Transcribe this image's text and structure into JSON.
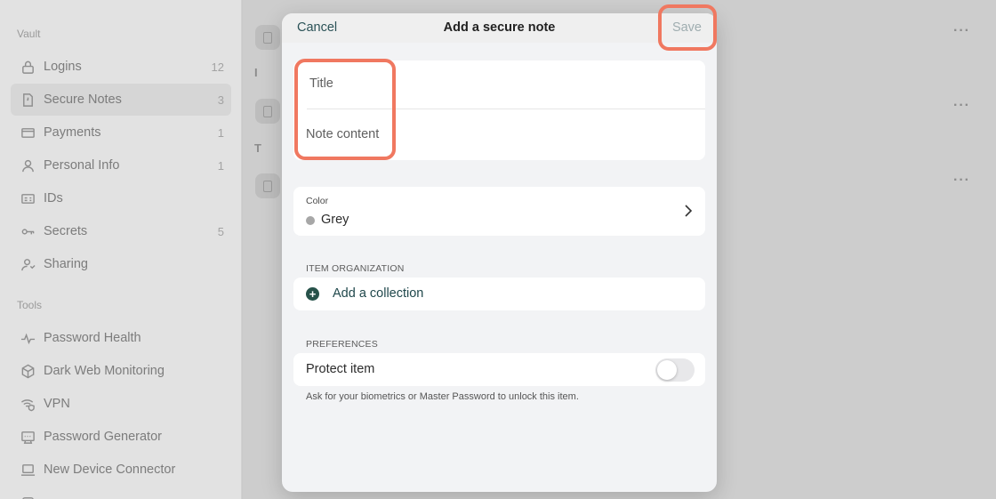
{
  "sidebar": {
    "vault_label": "Vault",
    "tools_label": "Tools",
    "vault_items": [
      {
        "label": "Logins",
        "count": "12",
        "icon": "lock-icon"
      },
      {
        "label": "Secure Notes",
        "count": "3",
        "icon": "note-icon",
        "active": true
      },
      {
        "label": "Payments",
        "count": "1",
        "icon": "card-icon"
      },
      {
        "label": "Personal Info",
        "count": "1",
        "icon": "person-icon"
      },
      {
        "label": "IDs",
        "count": "",
        "icon": "id-icon"
      },
      {
        "label": "Secrets",
        "count": "5",
        "icon": "key-icon"
      },
      {
        "label": "Sharing",
        "count": "",
        "icon": "sharing-icon"
      }
    ],
    "tool_items": [
      {
        "label": "Password Health",
        "icon": "pulse-icon"
      },
      {
        "label": "Dark Web Monitoring",
        "icon": "cube-icon"
      },
      {
        "label": "VPN",
        "icon": "wifi-shield-icon"
      },
      {
        "label": "Password Generator",
        "icon": "generator-icon"
      },
      {
        "label": "New Device Connector",
        "icon": "laptop-icon"
      }
    ]
  },
  "list": {
    "letters": [
      "I",
      "T"
    ]
  },
  "modal": {
    "cancel_label": "Cancel",
    "title": "Add a secure note",
    "save_label": "Save",
    "title_placeholder": "Title",
    "content_placeholder": "Note content",
    "color_label": "Color",
    "color_value": "Grey",
    "color_swatch": "#a7a7a7",
    "item_org_label": "ITEM ORGANIZATION",
    "add_collection_label": "Add a collection",
    "preferences_label": "PREFERENCES",
    "protect_label": "Protect item",
    "protect_enabled": false,
    "protect_help": "Ask for your biometrics or Master Password to unlock this item."
  },
  "colors": {
    "accent": "#27524a",
    "highlight": "#f07860"
  }
}
